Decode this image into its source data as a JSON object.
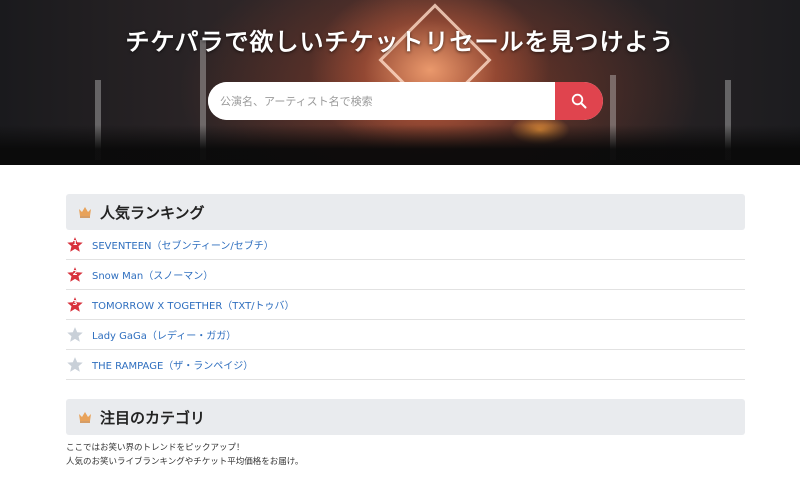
{
  "hero": {
    "title": "チケパラで欲しいチケットリセールを見つけよう",
    "search_placeholder": "公演名、アーティスト名で検索"
  },
  "ranking": {
    "heading": "人気ランキング",
    "items": [
      {
        "rank": "1",
        "label": "SEVENTEEN（セブンティーン/セブチ）",
        "star_color": "#d8323d"
      },
      {
        "rank": "2",
        "label": "Snow Man（スノーマン）",
        "star_color": "#d8323d"
      },
      {
        "rank": "3",
        "label": "TOMORROW X TOGETHER（TXT/トゥバ）",
        "star_color": "#d8323d"
      },
      {
        "rank": "",
        "label": "Lady GaGa（レディー・ガガ）",
        "star_color": "#c9d0d8"
      },
      {
        "rank": "",
        "label": "THE RAMPAGE（ザ・ランペイジ）",
        "star_color": "#c9d0d8"
      }
    ]
  },
  "category": {
    "heading": "注目のカテゴリ",
    "desc_line1": "ここではお笑い界のトレンドをピックアップ！",
    "desc_line2": "人気のお笑いライブランキングやチケット平均価格をお届け。"
  },
  "colors": {
    "accent": "#e0444e",
    "link": "#2f6fbf",
    "section_bg": "#e9ebee",
    "crown": "#e8a25a"
  }
}
